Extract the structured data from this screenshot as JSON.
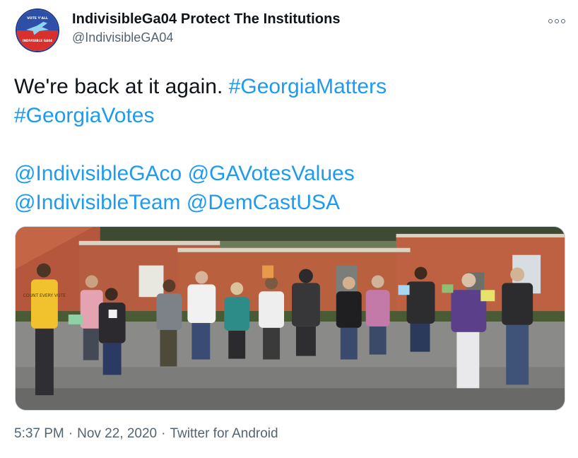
{
  "tweet": {
    "author": {
      "display_name": "IndivisibleGa04 Protect The Institutions",
      "handle": "@IndivisibleGA04",
      "avatar_text_top": "VOTE Y'ALL",
      "avatar_text_bottom": "INDIVISIBLE GA04"
    },
    "more_icon": "more-horizontal-icon",
    "text_plain": "We're back at it again.",
    "hashtags": [
      "#GeorgiaMatters",
      "#GeorgiaVotes"
    ],
    "mentions": [
      "@IndivisibleGAco",
      "@GAVotesValues",
      "@IndivisibleTeam",
      "@DemCastUSA"
    ],
    "photo": {
      "sign_text": "COUNT EVERY VOTE"
    },
    "time": "5:37 PM",
    "date": "Nov 22, 2020",
    "separator": "·",
    "source": "Twitter for Android"
  },
  "colors": {
    "link": "#1d9bf0",
    "text": "#0f1419",
    "secondary": "#536471"
  }
}
